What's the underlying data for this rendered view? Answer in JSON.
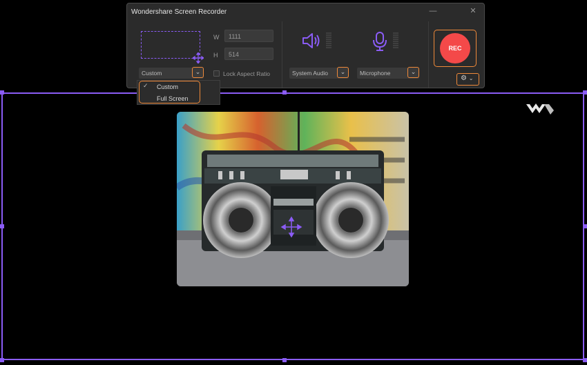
{
  "window": {
    "title": "Wondershare Screen Recorder"
  },
  "region": {
    "width_label": "W",
    "width_value": "1111",
    "height_label": "H",
    "height_value": "514",
    "mode_selected": "Custom",
    "lock_aspect_label": "Lock Aspect Ratio",
    "mode_options": [
      "Custom",
      "Full Screen"
    ]
  },
  "audio": {
    "system_audio": "System Audio",
    "microphone": "Microphone"
  },
  "rec": {
    "label": "REC"
  },
  "colors": {
    "accent": "#8b5cf6",
    "highlight": "#f08a3a",
    "rec": "#f44949"
  }
}
